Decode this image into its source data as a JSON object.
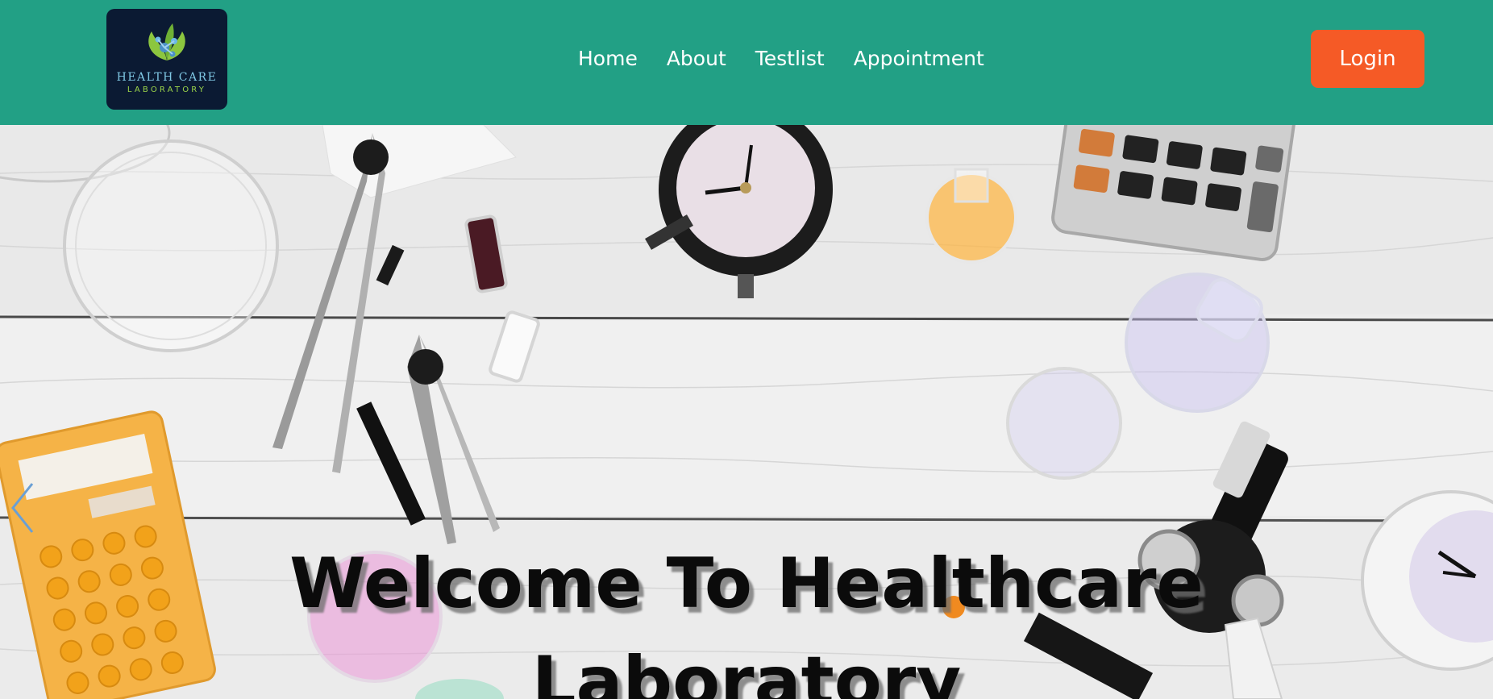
{
  "brand": {
    "name_line1": "HEALTH CARE",
    "name_line2": "LABORATORY",
    "logo_icon": "leaf-molecule-logo"
  },
  "nav": {
    "items": [
      {
        "label": "Home"
      },
      {
        "label": "About"
      },
      {
        "label": "Testlist"
      },
      {
        "label": "Appointment"
      }
    ]
  },
  "header": {
    "login_label": "Login"
  },
  "hero": {
    "title_line1": "Welcome  To Healthcare",
    "title_line2": "Laboratory",
    "prev_icon": "chevron-left-icon"
  },
  "colors": {
    "header_bg": "#22a085",
    "logo_bg": "#0b1a33",
    "login_bg": "#f55a26",
    "nav_text": "#ffffff",
    "hero_text": "#0b0b0b"
  }
}
